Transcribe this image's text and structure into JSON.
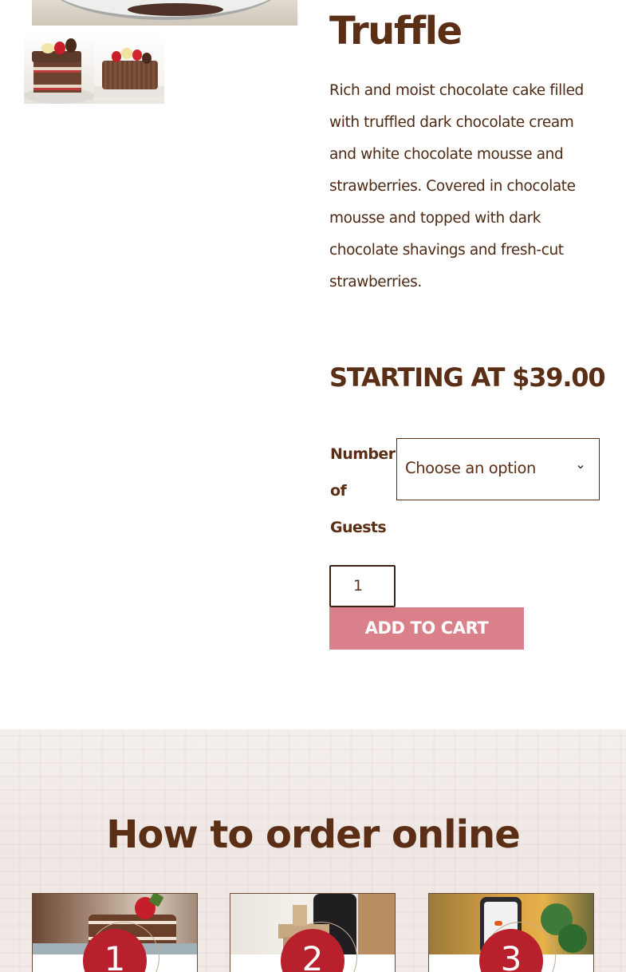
{
  "product": {
    "title": "Truffle",
    "description": "Rich and moist chocolate cake filled with truffled dark chocolate cream and white chocolate mousse and strawberries. Covered in chocolate mousse and topped with dark chocolate shavings and fresh-cut strawberries.",
    "price": "STARTING AT $39.00"
  },
  "options": {
    "guests_label": "Number of Guests",
    "select_value": "Choose an option"
  },
  "cart": {
    "quantity": "1",
    "button_label": "ADD TO CART"
  },
  "how_to_order": {
    "heading": "How to order online",
    "steps": [
      {
        "number": "1"
      },
      {
        "number": "2"
      },
      {
        "number": "3"
      }
    ]
  },
  "colors": {
    "brand_brown": "#5a2f16",
    "button_pink": "#d9808a",
    "step_red": "#b8202b"
  }
}
